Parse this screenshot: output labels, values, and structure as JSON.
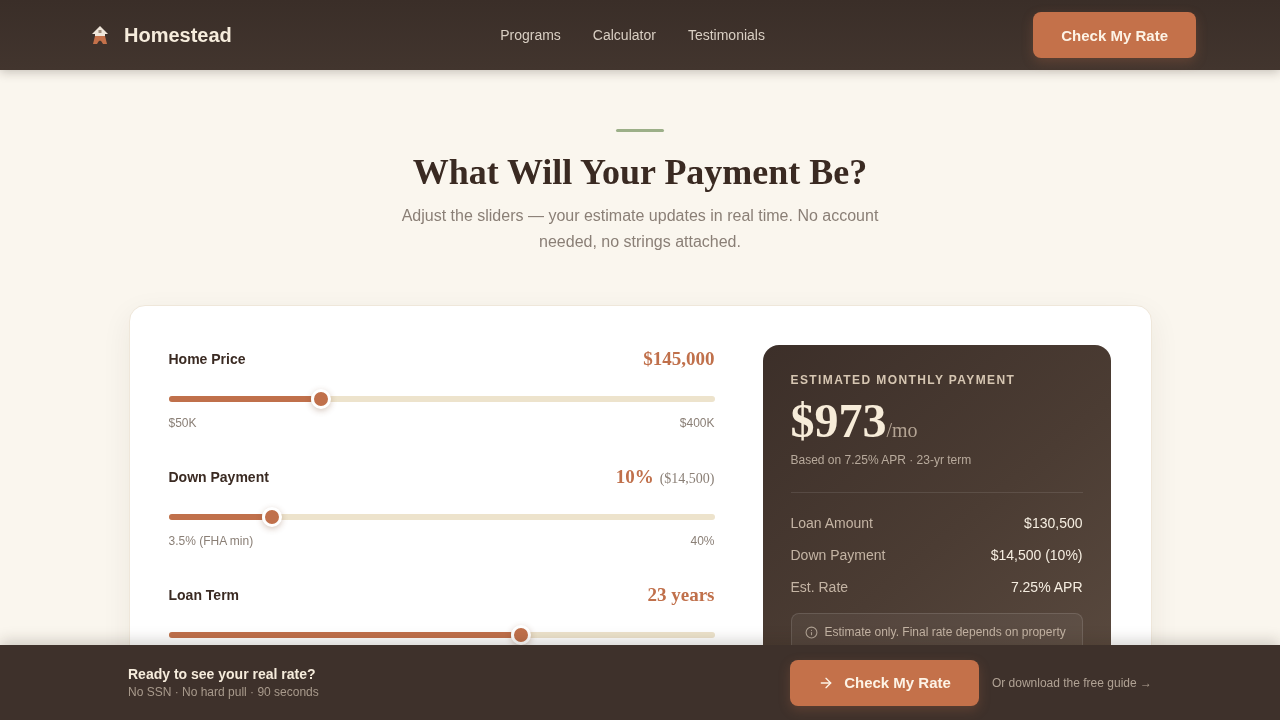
{
  "header": {
    "brand": "Homestead",
    "nav": [
      {
        "label": "Programs"
      },
      {
        "label": "Calculator"
      },
      {
        "label": "Testimonials"
      }
    ],
    "cta": "Check My Rate"
  },
  "hero": {
    "title": "What Will Your Payment Be?",
    "subtitle": "Adjust the sliders — your estimate updates in real time. No account needed, no strings attached."
  },
  "sliders": [
    {
      "label": "Home Price",
      "value": "$145,000",
      "level": 0.28,
      "min_label": "$50K",
      "max_label": "$400K"
    },
    {
      "label": "Down Payment",
      "value": "10%",
      "value_note": "($14,500)",
      "level": 0.19,
      "min_label": "3.5% (FHA min)",
      "max_label": "40%"
    },
    {
      "label": "Loan Term",
      "value": "23 years",
      "level": 0.645
    }
  ],
  "summary": {
    "eyebrow": "ESTIMATED MONTHLY PAYMENT",
    "amount": "$973",
    "unit": "/mo",
    "basis": "Based on 7.25% APR · 23-yr term",
    "rows": [
      {
        "label": "Loan Amount",
        "value": "$130,500"
      },
      {
        "label": "Down Payment",
        "value": "$14,500 (10%)"
      },
      {
        "label": "Est. Rate",
        "value": "7.25% APR"
      }
    ],
    "note": "Estimate only. Final rate depends on property"
  },
  "sticky_bar": {
    "title": "Ready to see your real rate?",
    "subtitle": "No SSN · No hard pull · 90 seconds",
    "cta": "Check My Rate",
    "link": "Or download the free guide →"
  }
}
